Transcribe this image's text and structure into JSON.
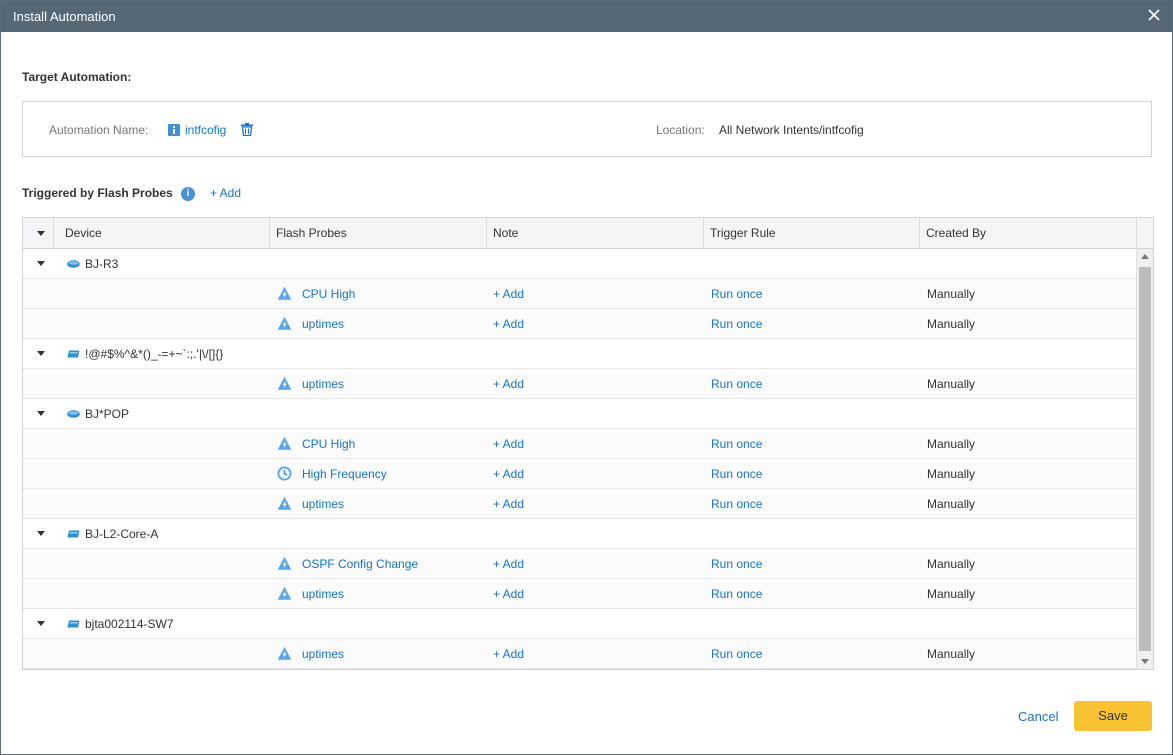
{
  "dialog": {
    "title": "Install Automation"
  },
  "target": {
    "section_label": "Target Automation:",
    "name_label": "Automation Name:",
    "name_value": "intfcofig",
    "location_label": "Location:",
    "location_value": "All Network Intents/intfcofig"
  },
  "triggered": {
    "section_label": "Triggered by Flash Probes",
    "add_label": "+ Add"
  },
  "grid": {
    "columns": [
      "Device",
      "Flash Probes",
      "Note",
      "Trigger Rule",
      "Created By"
    ],
    "groups": [
      {
        "device": "BJ-R3",
        "icon": "router-icon",
        "probes": [
          {
            "name": "CPU High",
            "icon": "flash-probe-icon",
            "note": "+ Add",
            "trigger": "Run once",
            "created_by": "Manually"
          },
          {
            "name": "uptimes",
            "icon": "flash-probe-icon",
            "note": "+ Add",
            "trigger": "Run once",
            "created_by": "Manually"
          }
        ]
      },
      {
        "device": "!@#$%^&*()_-=+~`:;.'|\\/[]{}",
        "icon": "switch-icon",
        "probes": [
          {
            "name": "uptimes",
            "icon": "flash-probe-icon",
            "note": "+ Add",
            "trigger": "Run once",
            "created_by": "Manually"
          }
        ]
      },
      {
        "device": "BJ*POP",
        "icon": "router-icon",
        "probes": [
          {
            "name": "CPU High",
            "icon": "flash-probe-icon",
            "note": "+ Add",
            "trigger": "Run once",
            "created_by": "Manually"
          },
          {
            "name": "High Frequency",
            "icon": "clock-probe-icon",
            "note": "+ Add",
            "trigger": "Run once",
            "created_by": "Manually"
          },
          {
            "name": "uptimes",
            "icon": "flash-probe-icon",
            "note": "+ Add",
            "trigger": "Run once",
            "created_by": "Manually"
          }
        ]
      },
      {
        "device": "BJ-L2-Core-A",
        "icon": "switch-icon",
        "probes": [
          {
            "name": "OSPF Config Change",
            "icon": "flash-probe-icon",
            "note": "+ Add",
            "trigger": "Run once",
            "created_by": "Manually"
          },
          {
            "name": "uptimes",
            "icon": "flash-probe-icon",
            "note": "+ Add",
            "trigger": "Run once",
            "created_by": "Manually"
          }
        ]
      },
      {
        "device": "bjta002114-SW7",
        "icon": "switch-icon",
        "probes": [
          {
            "name": "uptimes",
            "icon": "flash-probe-icon",
            "note": "+ Add",
            "trigger": "Run once",
            "created_by": "Manually"
          }
        ]
      }
    ]
  },
  "footer": {
    "cancel_label": "Cancel",
    "save_label": "Save"
  },
  "colors": {
    "titlebar": "#566876",
    "link": "#1a73c5",
    "save_button": "#f9c232"
  }
}
